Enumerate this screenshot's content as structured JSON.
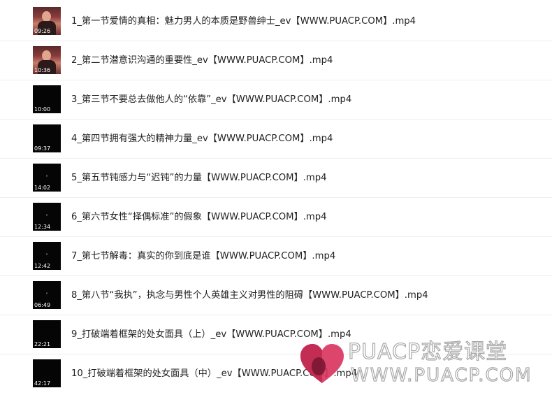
{
  "files": [
    {
      "name": "1_第一节爱情的真相：魅力男人的本质是野兽绅士_ev【WWW.PUACP.COM】.mp4",
      "duration": "09:26",
      "thumbnail": "person"
    },
    {
      "name": "2_第二节潜意识沟通的重要性_ev【WWW.PUACP.COM】.mp4",
      "duration": "10:36",
      "thumbnail": "person"
    },
    {
      "name": "3_第三节不要总去做他人的“依靠”_ev【WWW.PUACP.COM】.mp4",
      "duration": "10:00",
      "thumbnail": "dark"
    },
    {
      "name": "4_第四节拥有强大的精神力量_ev【WWW.PUACP.COM】.mp4",
      "duration": "09:37",
      "thumbnail": "dark"
    },
    {
      "name": "5_第五节钝感力与“迟钝”的力量【WWW.PUACP.COM】.mp4",
      "duration": "14:02",
      "thumbnail": "dark"
    },
    {
      "name": "6_第六节女性“择偶标准”的假象【WWW.PUACP.COM】.mp4",
      "duration": "12:34",
      "thumbnail": "dark"
    },
    {
      "name": "7_第七节解毒：真实的你到底是谁【WWW.PUACP.COM】.mp4",
      "duration": "12:42",
      "thumbnail": "dark"
    },
    {
      "name": "8_第八节“我执”，执念与男性个人英雄主义对男性的阻碍【WWW.PUACP.COM】.mp4",
      "duration": "06:49",
      "thumbnail": "dark"
    },
    {
      "name": "9_打破端着框架的处女面具（上）_ev【WWW.PUACP.COM】.mp4",
      "duration": "22:21",
      "thumbnail": "dark"
    },
    {
      "name": "10_打破端着框架的处女面具（中）_ev【WWW.PUACP.COM】.mp4",
      "duration": "42:17",
      "thumbnail": "dark"
    }
  ],
  "watermark": {
    "title": "PUACP恋爱课堂",
    "url": "WWW.PUACP.COM",
    "colors": {
      "heart_main": "#d9365f",
      "heart_left": "#c02a52",
      "heart_dark": "#7a1632"
    }
  }
}
